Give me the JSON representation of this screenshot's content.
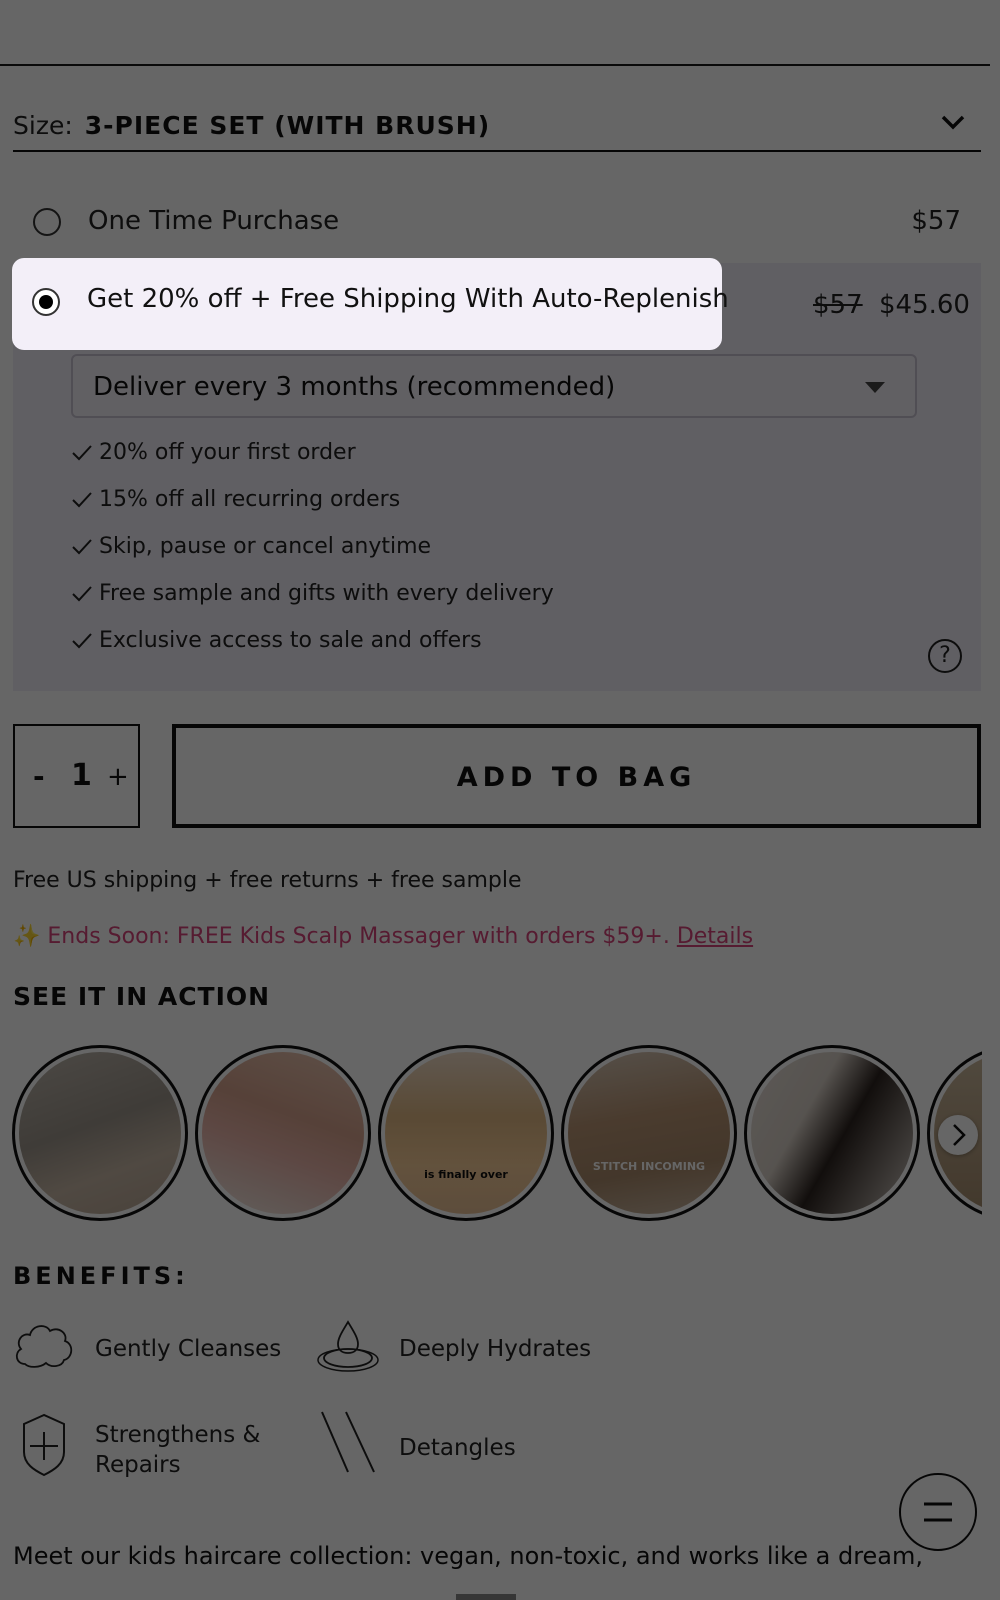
{
  "size_selector": {
    "label": "Size:",
    "value": "3-PIECE SET (WITH BRUSH)",
    "icon": "chevron-down-icon"
  },
  "purchase_options": {
    "one_time": {
      "label": "One Time Purchase",
      "price": "$57",
      "selected": false
    },
    "subscribe": {
      "label": "Get 20% off + Free Shipping  With Auto-Replenish",
      "old_price": "$57",
      "new_price": "$45.60",
      "selected": true
    }
  },
  "delivery": {
    "value": "Deliver every 3 months (recommended)"
  },
  "perks": [
    "20% off your first order",
    "15% off all recurring orders",
    "Skip, pause or cancel anytime",
    "Free sample and gifts with every delivery",
    "Exclusive access to sale and offers"
  ],
  "help_icon": "?",
  "quantity": {
    "minus": "-",
    "value": "1",
    "plus": "+"
  },
  "add_to_bag": "ADD TO BAG",
  "shipping_note": "Free US shipping + free returns + free sample",
  "promo": {
    "icon": "✨",
    "text": " Ends Soon: FREE Kids Scalp Massager with orders $59+. ",
    "link": "Details",
    "color": "#d6447a"
  },
  "see_it_in_action": {
    "title": "SEE IT IN ACTION",
    "videos": [
      {
        "caption": ""
      },
      {
        "caption": ""
      },
      {
        "caption": "is finally over"
      },
      {
        "caption": "STITCH INCOMING"
      },
      {
        "caption": ""
      }
    ]
  },
  "benefits": {
    "title": "BENEFITS:",
    "items": [
      {
        "label": "Gently Cleanses",
        "icon": "cloud-icon"
      },
      {
        "label": "Deeply Hydrates",
        "icon": "water-drop-icon"
      },
      {
        "label": "Strengthens &",
        "label2": "Repairs",
        "icon": "shield-plus-icon"
      },
      {
        "label": "Detangles",
        "icon": "detangle-lines-icon"
      }
    ]
  },
  "description": "Meet our kids haircare collection: vegan, non-toxic, and works like a dream,",
  "accent_color": "#d6447a"
}
